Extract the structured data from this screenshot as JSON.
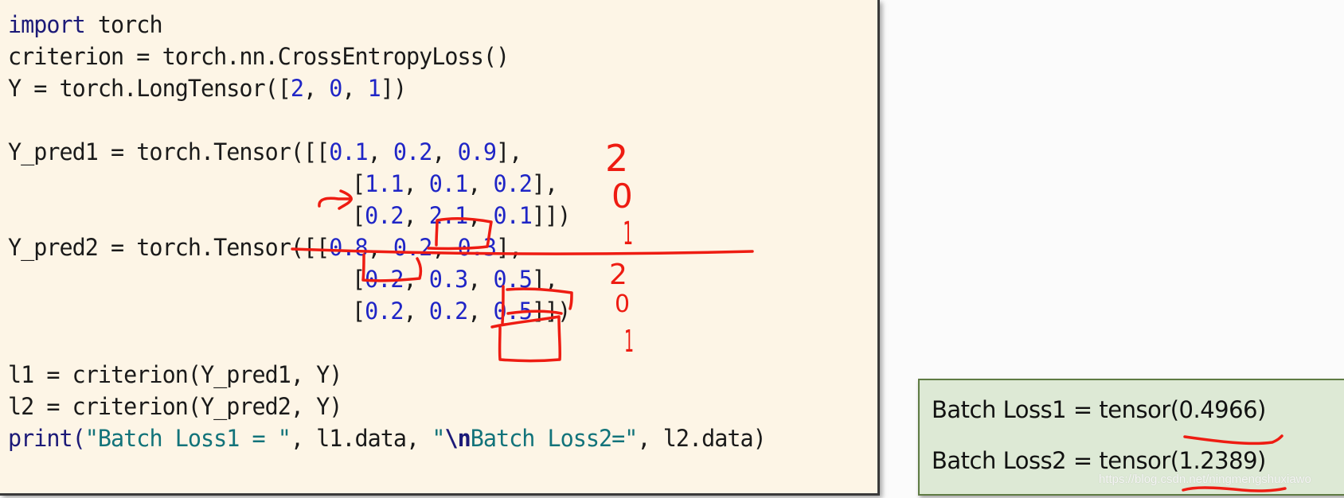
{
  "code": {
    "import_kw": "import",
    "import_mod": " torch",
    "line_criterion": "criterion = torch.nn.CrossEntropyLoss()",
    "line_y_prefix": "Y = torch.LongTensor([",
    "y_values": [
      "2",
      "0",
      "1"
    ],
    "line_y_suffix": "])",
    "y_pred1_prefix": "Y_pred1 = torch.Tensor([",
    "y_pred2_prefix": "Y_pred2 = torch.Tensor([",
    "y_pred1": [
      [
        "0.1",
        "0.2",
        "0.9"
      ],
      [
        "1.1",
        "0.1",
        "0.2"
      ],
      [
        "0.2",
        "2.1",
        "0.1"
      ]
    ],
    "y_pred2": [
      [
        "0.8",
        "0.2",
        "0.3"
      ],
      [
        "0.2",
        "0.3",
        "0.5"
      ],
      [
        "0.2",
        "0.2",
        "0.5"
      ]
    ],
    "line_l1": "l1 = criterion(Y_pred1, Y)",
    "line_l2": "l2 = criterion(Y_pred2, Y)",
    "print_fn": "print(",
    "print_str1": "\"Batch Loss1 = \"",
    "print_mid": ", l1.data, ",
    "print_str2_open": "\"",
    "print_esc": "\\n",
    "print_str2_rest": "Batch Loss2=\"",
    "print_end": ", l2.data)"
  },
  "output": {
    "line1": "Batch Loss1 = tensor(0.4966)",
    "line2": "Batch Loss2 = tensor(1.2389)"
  },
  "annotations": {
    "pred1_labels": [
      "2",
      "0",
      "1"
    ],
    "pred2_labels": [
      "2",
      "0",
      "1"
    ],
    "color": "#ee1c12"
  },
  "watermark": "https://blog.csdn.net/ningmengshuxiawo"
}
